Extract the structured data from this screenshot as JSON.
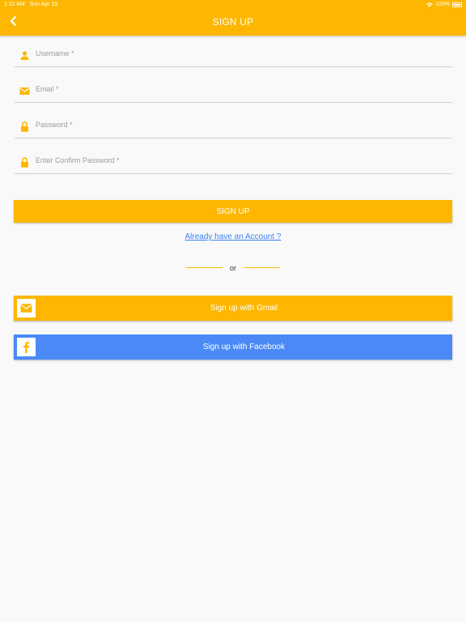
{
  "status_bar": {
    "time": "1:22 AM",
    "date": "Sun Apr 19",
    "battery": "100%"
  },
  "header": {
    "title": "SIGN UP"
  },
  "form": {
    "username_placeholder": "Username *",
    "email_placeholder": "Email *",
    "password_placeholder": "Password *",
    "confirm_password_placeholder": "Enter Confirm Password *"
  },
  "actions": {
    "signup_label": "SIGN UP",
    "login_link": "Already have an Account ?",
    "divider_text": "or",
    "gmail_label": "Sign up with Gmail",
    "facebook_label": "Sign up with Facebook"
  },
  "colors": {
    "accent": "#fdb700",
    "facebook": "#4b8af6",
    "link": "#3b82f6"
  },
  "icons": [
    "back-chevron-icon",
    "user-icon",
    "mail-icon",
    "lock-icon",
    "facebook-icon"
  ]
}
